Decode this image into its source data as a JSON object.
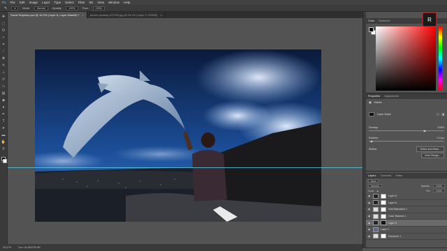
{
  "menu": [
    "File",
    "Edit",
    "Image",
    "Layer",
    "Type",
    "Select",
    "Filter",
    "3D",
    "View",
    "Window",
    "Help"
  ],
  "options": {
    "mode_label": "Mode:",
    "mode": "Normal",
    "opacity_label": "Opacity:",
    "opacity": "100%",
    "flow_label": "Flow:",
    "flow": "100%"
  },
  "tabs": [
    {
      "title": "Sanaf Dolphins.psd @ 16.4% (Layer 8, Layer Mask/8) *",
      "active": true
    },
    {
      "title": "pexels-pixabay-372990.jpg @ 18.1% (Layer 0, RGB/8)",
      "active": false
    }
  ],
  "status": {
    "zoom": "16.27%",
    "doc": "Doc: 46.4M/705.9M"
  },
  "color_panel": {
    "tabs": [
      "Color",
      "Swatches"
    ]
  },
  "properties_panel": {
    "tabs": [
      "Properties",
      "Adjustments"
    ],
    "header": "Masks",
    "mask_label": "Layer Mask",
    "density_label": "Density:",
    "density": "100%",
    "feather_label": "Feather:",
    "feather": "0.0 px",
    "refine_label": "Refine:",
    "select_mask_button": "Select and Mask...",
    "color_range_button": "Color Range..."
  },
  "layers_panel": {
    "tabs": [
      "Layers",
      "Channels",
      "Paths"
    ],
    "kind_label": "Kind",
    "blend": "Normal",
    "opacity_label": "Opacity:",
    "opacity": "100%",
    "lock_label": "Lock:",
    "fill_label": "Fill:",
    "fill": "100%",
    "layers": [
      {
        "name": "Layer 8",
        "selected": false
      },
      {
        "name": "Layer 6",
        "selected": false
      },
      {
        "name": "Hue/Saturation 1",
        "selected": false
      },
      {
        "name": "Color Balance 1",
        "selected": false
      },
      {
        "name": "Layer 3",
        "selected": true
      },
      {
        "name": "Layer 1",
        "selected": false
      },
      {
        "name": "Exposure 1",
        "selected": false
      }
    ]
  },
  "colors": {
    "menu_bg": "#424242",
    "workspace_bg": "#535353",
    "guide": "#5fd0e6",
    "selected_layer": "#6b6b6b"
  }
}
